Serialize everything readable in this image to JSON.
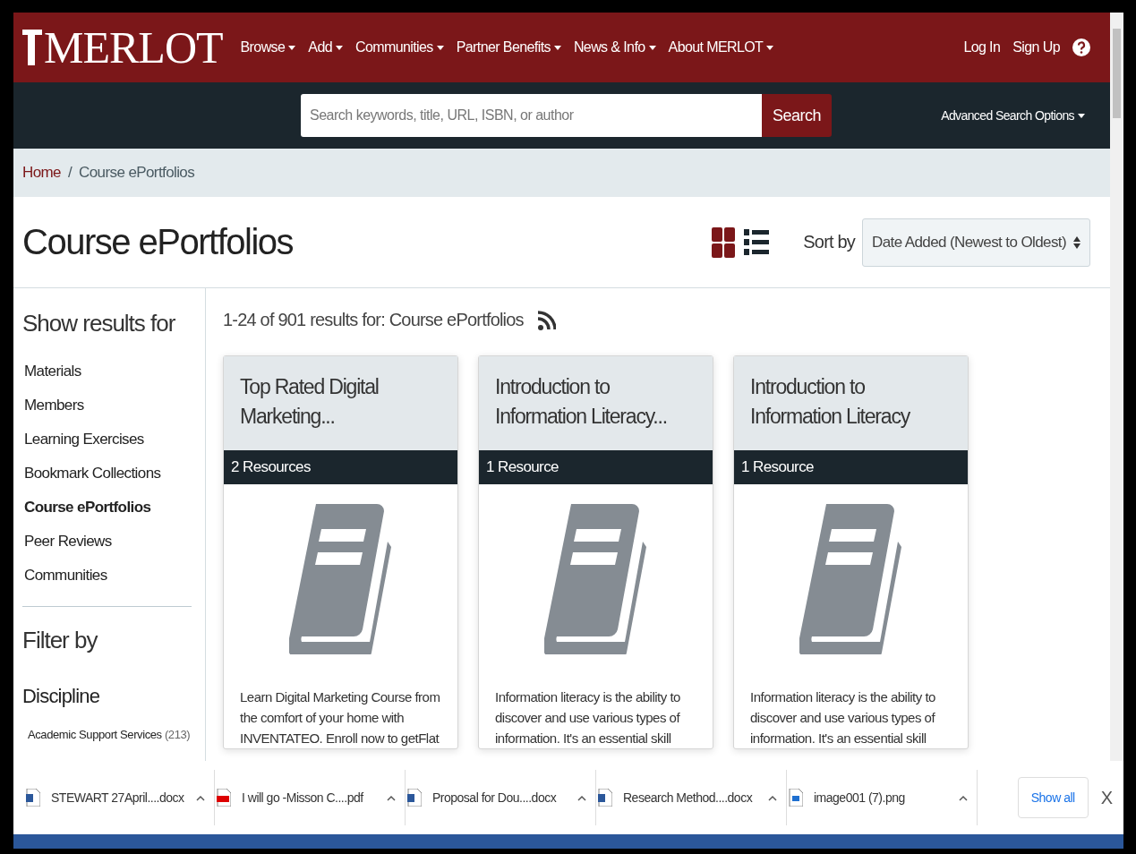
{
  "header": {
    "logo": "MERLOT",
    "nav": [
      {
        "label": "Browse"
      },
      {
        "label": "Add"
      },
      {
        "label": "Communities"
      },
      {
        "label": "Partner Benefits"
      },
      {
        "label": "News & Info"
      },
      {
        "label": "About MERLOT"
      }
    ],
    "login": "Log In",
    "signup": "Sign Up"
  },
  "search": {
    "placeholder": "Search keywords, title, URL, ISBN, or author",
    "button": "Search",
    "advanced": "Advanced Search Options"
  },
  "breadcrumb_separator": "/",
  "breadcrumb": [
    {
      "label": "Home",
      "link": true
    },
    {
      "label": "Course ePortfolios",
      "link": false
    }
  ],
  "page_title": "Course ePortfolios",
  "view": {
    "grid_selected": true
  },
  "sort": {
    "label": "Sort by",
    "value": "Date Added (Newest to Oldest)"
  },
  "sidebar": {
    "title": "Show results for",
    "items": [
      {
        "label": "Materials",
        "selected": false
      },
      {
        "label": "Members",
        "selected": false
      },
      {
        "label": "Learning Exercises",
        "selected": false
      },
      {
        "label": "Bookmark Collections",
        "selected": false
      },
      {
        "label": "Course ePortfolios",
        "selected": true
      },
      {
        "label": "Peer Reviews",
        "selected": false
      },
      {
        "label": "Communities",
        "selected": false
      }
    ],
    "filter_title": "Filter by",
    "discipline_title": "Discipline",
    "disciplines": [
      {
        "label": "Academic Support Services",
        "count": "(213)"
      }
    ]
  },
  "results": {
    "summary": "1-24 of 901 results for: Course ePortfolios",
    "cards": [
      {
        "title": "Top Rated Digital Marketing...",
        "resources": "2 Resources",
        "description": "Learn Digital Marketing Course from the comfort of your home with INVENTATEO. Enroll now to getFlat"
      },
      {
        "title": "Introduction to Information Literacy...",
        "resources": "1 Resource",
        "description": "Information literacy is the ability to discover and use various types of information. It's an essential skill"
      },
      {
        "title": "Introduction to Information Literacy",
        "resources": "1 Resource",
        "description": "Information literacy is the ability to discover and use various types of information. It's an essential skill"
      }
    ]
  },
  "downloads": {
    "items": [
      {
        "name": "STEWART 27April....docx",
        "kind": "word"
      },
      {
        "name": "I will go -Misson C....pdf",
        "kind": "pdf"
      },
      {
        "name": "Proposal for Dou....docx",
        "kind": "word"
      },
      {
        "name": "Research Method....docx",
        "kind": "word"
      },
      {
        "name": "image001 (7).png",
        "kind": "image"
      }
    ],
    "show_all": "Show all",
    "close": "X"
  }
}
